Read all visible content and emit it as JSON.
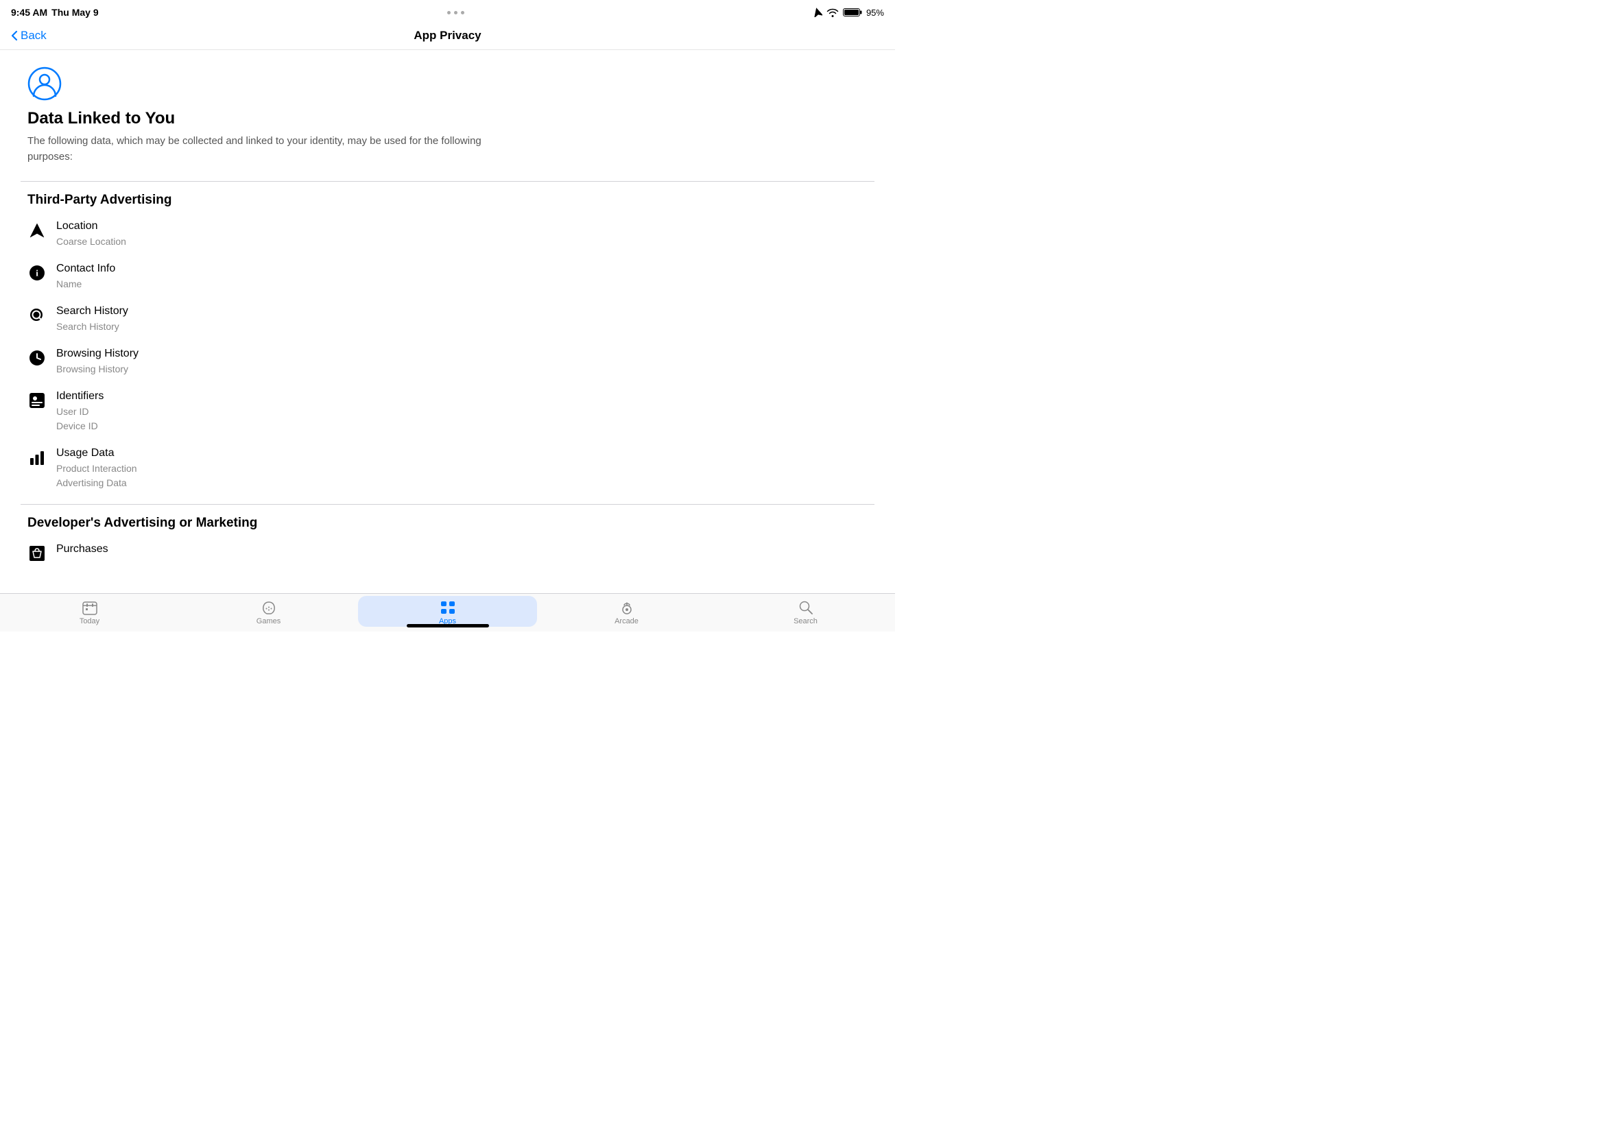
{
  "status_bar": {
    "time": "9:45 AM",
    "date": "Thu May 9",
    "battery": "95%"
  },
  "nav": {
    "back_label": "Back",
    "title": "App Privacy"
  },
  "header": {
    "title": "Data Linked to You",
    "description": "The following data, which may be collected and linked to your identity, may be used for the following purposes:"
  },
  "sections": [
    {
      "title": "Third-Party Advertising",
      "items": [
        {
          "icon": "location",
          "label": "Location",
          "sub": "Coarse Location"
        },
        {
          "icon": "info",
          "label": "Contact Info",
          "sub": "Name"
        },
        {
          "icon": "search",
          "label": "Search History",
          "sub": "Search History"
        },
        {
          "icon": "browsing",
          "label": "Browsing History",
          "sub": "Browsing History"
        },
        {
          "icon": "id",
          "label": "Identifiers",
          "sub": "User ID\nDevice ID"
        },
        {
          "icon": "usage",
          "label": "Usage Data",
          "sub": "Product Interaction\nAdvertising Data"
        }
      ]
    },
    {
      "title": "Developer's Advertising or Marketing",
      "items": [
        {
          "icon": "purchases",
          "label": "Purchases",
          "sub": ""
        }
      ]
    }
  ],
  "tab_bar": {
    "items": [
      {
        "id": "today",
        "label": "Today",
        "icon": "today"
      },
      {
        "id": "games",
        "label": "Games",
        "icon": "games"
      },
      {
        "id": "apps",
        "label": "Apps",
        "icon": "apps",
        "active": true
      },
      {
        "id": "arcade",
        "label": "Arcade",
        "icon": "arcade"
      },
      {
        "id": "search",
        "label": "Search",
        "icon": "search"
      }
    ]
  }
}
